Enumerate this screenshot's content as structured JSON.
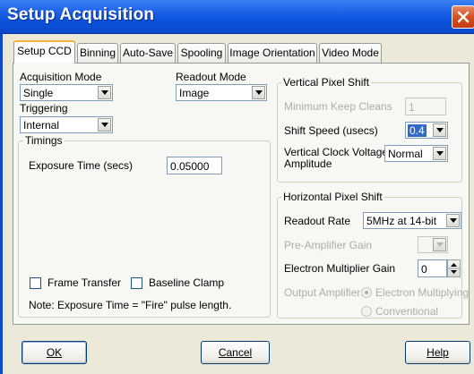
{
  "window": {
    "title": "Setup Acquisition"
  },
  "tabs": [
    {
      "label": "Setup CCD",
      "active": true
    },
    {
      "label": "Binning"
    },
    {
      "label": "Auto-Save"
    },
    {
      "label": "Spooling"
    },
    {
      "label": "Image Orientation"
    },
    {
      "label": "Video Mode"
    }
  ],
  "acquisition_mode": {
    "label": "Acquisition Mode",
    "value": "Single"
  },
  "readout_mode": {
    "label": "Readout Mode",
    "value": "Image"
  },
  "triggering": {
    "label": "Triggering",
    "value": "Internal"
  },
  "timings": {
    "title": "Timings",
    "exposure_label": "Exposure Time (secs)",
    "exposure_value": "0.05000"
  },
  "frame_transfer": {
    "label": "Frame Transfer",
    "checked": false
  },
  "baseline_clamp": {
    "label": "Baseline Clamp",
    "checked": false
  },
  "note": "Note: Exposure Time = \"Fire\" pulse length.",
  "vertical_shift": {
    "title": "Vertical Pixel Shift",
    "min_keep_cleans_label": "Minimum Keep Cleans",
    "min_keep_cleans_value": "1",
    "shift_speed_label": "Shift Speed (usecs)",
    "shift_speed_value": "0.4",
    "clock_voltage_label_1": "Vertical Clock Voltage",
    "clock_voltage_label_2": "Amplitude",
    "clock_voltage_value": "Normal"
  },
  "horizontal_shift": {
    "title": "Horizontal Pixel Shift",
    "readout_rate_label": "Readout Rate",
    "readout_rate_value": "5MHz at 14-bit",
    "preamp_label": "Pre-Amplifier Gain",
    "preamp_value": "",
    "em_gain_label": "Electron Multiplier Gain",
    "em_gain_value": "0",
    "output_amp_label": "Output Amplifier:",
    "output_amp_options": [
      "Electron Multiplying",
      "Conventional"
    ]
  },
  "buttons": {
    "ok": "OK",
    "cancel": "Cancel",
    "help": "Help"
  },
  "colors": {
    "titlebar": "#0a4fd8",
    "tab_highlight": "#f7b336",
    "selection": "#316ac5",
    "close_button": "#d4501f"
  }
}
